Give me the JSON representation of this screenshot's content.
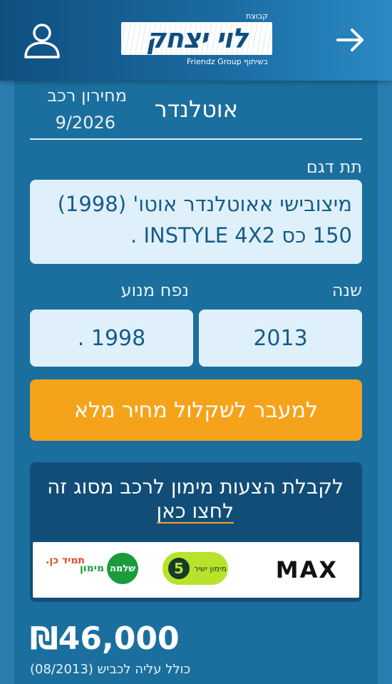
{
  "header": {
    "logo_top": "קבוצת",
    "logo_name": "לוי יצחק",
    "logo_bottom": "Friendz Group בשיתוף",
    "user_icon": "user-icon",
    "back_icon": "arrow-right-icon"
  },
  "vehicle": {
    "price_list_label": "מחירון רכב",
    "price_list_date": "9/2026",
    "model_name": "אוטלנדר"
  },
  "fields": {
    "submodel_label": "תת דגם",
    "submodel_value": "מיצובישי אאוטלנדר אוטו' (1998) 150 כס INSTYLE 4X2 .",
    "year_label": "שנה",
    "year_value": "2013",
    "engine_label": "נפח מנוע",
    "engine_value": "1998 ."
  },
  "cta": {
    "label": "למעבר לשקלול מחיר מלא",
    "color": "#f6a31c"
  },
  "insurance": {
    "line1": "לקבלת הצעות מימון לרכב מסוג זה",
    "link": "לחצו כאן",
    "partners": {
      "max": "MAX",
      "direct_num": "5",
      "direct_text": "מימון ישיר",
      "shlomo_logo": "שלמה",
      "shlomo_text": "מימון",
      "tamid": "תמיד כן."
    }
  },
  "result": {
    "price": "₪46,000",
    "note": "כולל עליה לכביש (08/2013)"
  }
}
